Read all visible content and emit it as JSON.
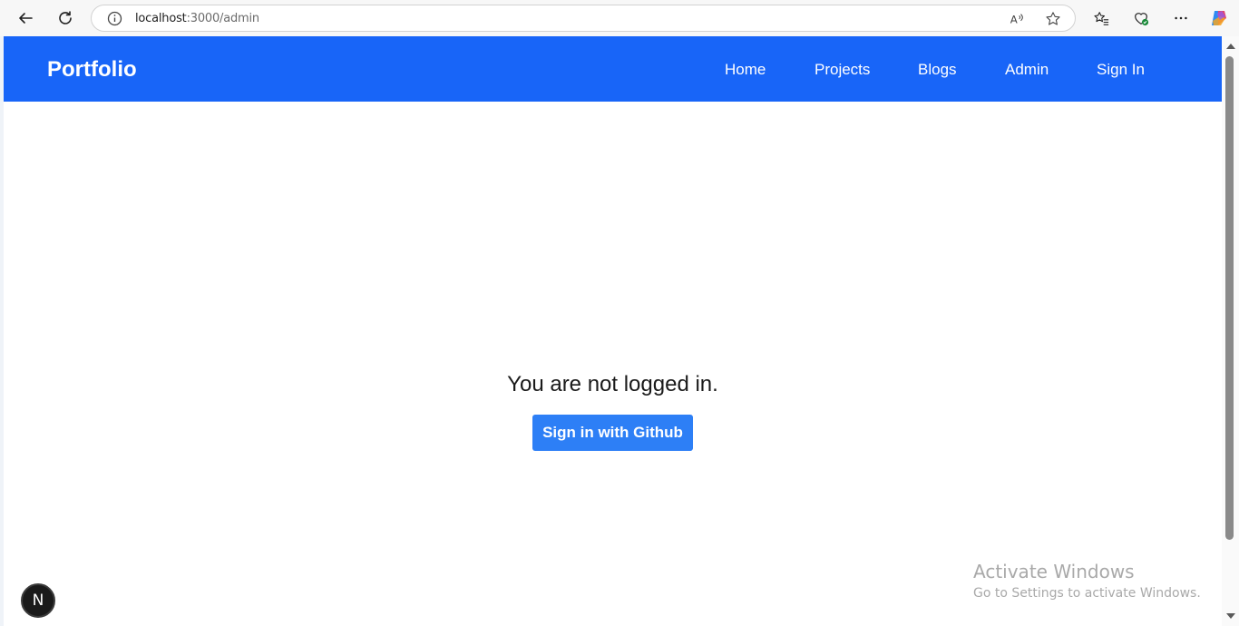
{
  "browser": {
    "url_host": "localhost",
    "url_path": ":3000/admin",
    "icons": [
      "back-arrow-icon",
      "refresh-icon",
      "site-info-icon",
      "read-aloud-icon",
      "favorite-star-icon",
      "favorites-icon",
      "browser-essentials-icon",
      "more-options-icon",
      "copilot-icon"
    ]
  },
  "navbar": {
    "brand": "Portfolio",
    "links": [
      "Home",
      "Projects",
      "Blogs",
      "Admin",
      "Sign In"
    ],
    "color": "#1865f8"
  },
  "main": {
    "message": "You are not logged in.",
    "signin_button": "Sign in with Github",
    "button_color": "#2d7ff6"
  },
  "dev_badge": {
    "letter": "N"
  },
  "watermark": {
    "title": "Activate Windows",
    "subtitle": "Go to Settings to activate Windows."
  }
}
